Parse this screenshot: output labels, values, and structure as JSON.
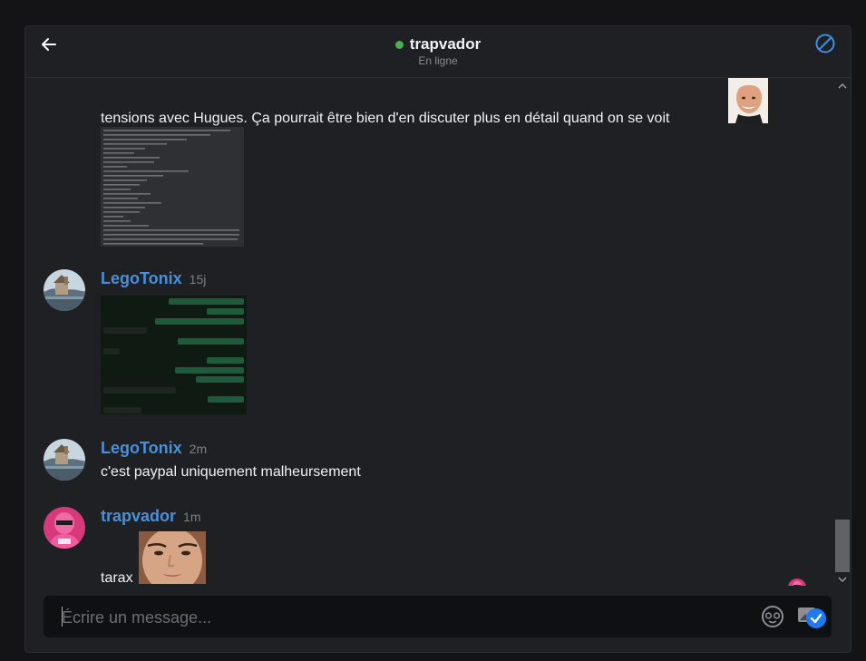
{
  "header": {
    "title": "trapvador",
    "status": "En ligne",
    "status_color": "#4caf50",
    "back_icon": "arrow-left-icon",
    "block_icon": "block-icon"
  },
  "messages": [
    {
      "author": "",
      "time": "",
      "text": "tensions avec Hugues. Ça pourrait être bien d'en discuter plus en détail quand on se voit",
      "attachment": "screenshot-of-text-conversation"
    },
    {
      "author": "LegoTonix",
      "time": "15j",
      "text": "",
      "attachment": "screenshot-of-whatsapp-chat"
    },
    {
      "author": "LegoTonix",
      "time": "2m",
      "text": "c'est paypal uniquement malheursement"
    },
    {
      "author": "trapvador",
      "time": "1m",
      "text": "tarax",
      "attachment": "face-photo"
    }
  ],
  "composer": {
    "placeholder": "Écrire un message...",
    "value": "",
    "emoji_icon": "emoji-icon",
    "image_icon": "image-upload-icon"
  },
  "colors": {
    "author": "#4a90d9",
    "accent": "#1d7bf0",
    "background": "#1f2024"
  }
}
